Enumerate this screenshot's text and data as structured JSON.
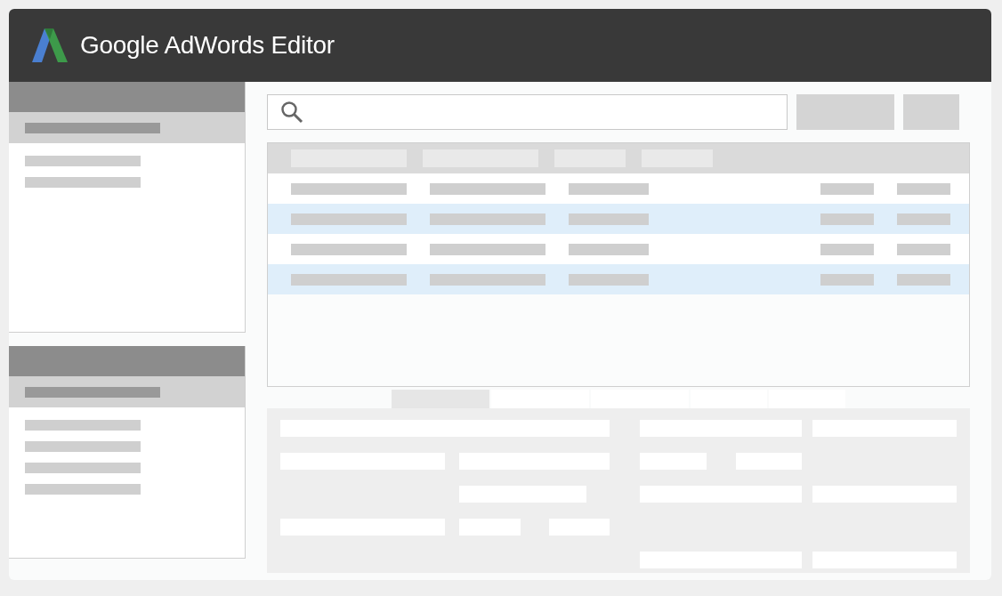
{
  "window": {
    "title": "Google AdWords Editor"
  },
  "sidebar": {
    "panels": [
      {
        "items": [
          {
            "selected": true
          },
          {
            "selected": false
          },
          {
            "selected": false
          }
        ]
      },
      {
        "items": [
          {
            "selected": true
          },
          {
            "selected": false
          },
          {
            "selected": false
          },
          {
            "selected": false
          },
          {
            "selected": false
          }
        ]
      }
    ]
  },
  "table": {
    "rows": [
      {
        "highlighted": false
      },
      {
        "highlighted": true
      },
      {
        "highlighted": false
      },
      {
        "highlighted": true
      }
    ]
  },
  "detail_tabs": [
    {
      "selected": true
    },
    {
      "selected": false
    },
    {
      "selected": false
    },
    {
      "selected": false
    },
    {
      "selected": false
    }
  ]
}
